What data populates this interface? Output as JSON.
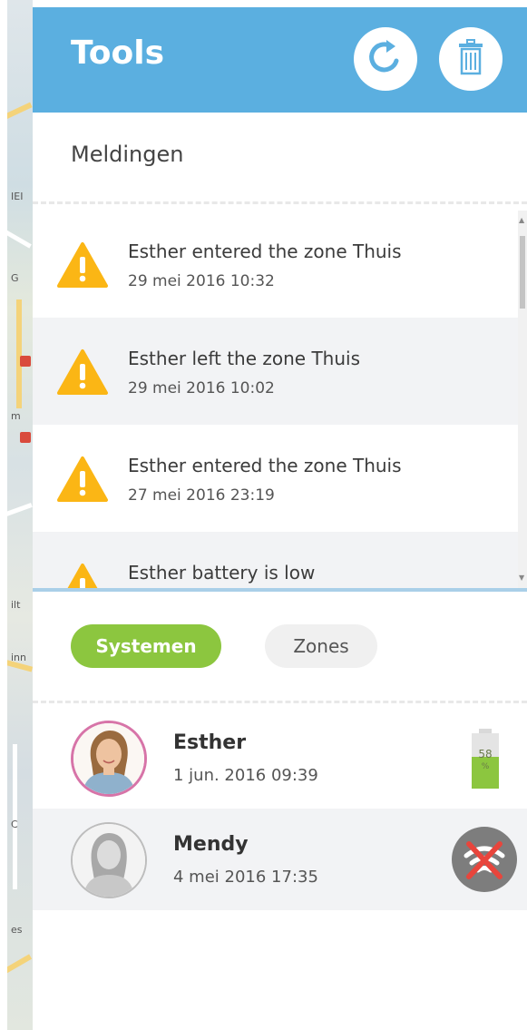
{
  "header": {
    "title": "Tools",
    "refresh_icon": "refresh-icon",
    "trash_icon": "trash-icon",
    "color": "#5bafe0"
  },
  "notifications": {
    "title": "Meldingen",
    "items": [
      {
        "message": "Esther entered the zone Thuis",
        "time": "29 mei 2016 10:32",
        "icon": "warning-icon"
      },
      {
        "message": "Esther left the zone Thuis",
        "time": "29 mei 2016 10:02",
        "icon": "warning-icon"
      },
      {
        "message": "Esther entered the zone Thuis",
        "time": "27 mei 2016 23:19",
        "icon": "warning-icon"
      },
      {
        "message": "Esther battery is low",
        "time": "",
        "icon": "warning-icon"
      }
    ],
    "warning_color": "#fbb615"
  },
  "tabs": {
    "active": "Systemen",
    "inactive": "Zones",
    "active_color": "#8cc63f"
  },
  "systems": [
    {
      "name": "Esther",
      "time": "1 jun. 2016 09:39",
      "battery_percent": "58",
      "battery_unit": "%",
      "battery_level": 0.58
    },
    {
      "name": "Mendy",
      "time": "4 mei 2016 17:35",
      "status_icon": "no-signal-icon"
    }
  ],
  "map": {
    "labels": [
      "IEI",
      "G",
      "m",
      "ilt",
      "inn",
      "C",
      "es"
    ]
  }
}
